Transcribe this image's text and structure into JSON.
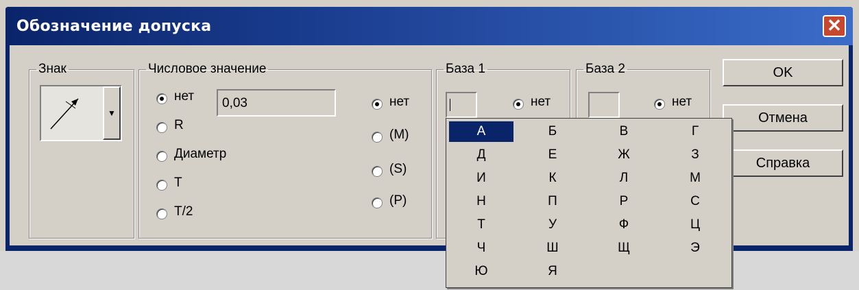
{
  "window": {
    "title": "Обозначение допуска",
    "close_label": "✕"
  },
  "sign_group": {
    "legend": "Знак",
    "dropdown_arrow": "▼"
  },
  "numeric_group": {
    "legend": "Числовое значение",
    "value": "0,03",
    "radios_left": [
      "нет",
      "R",
      "Диаметр",
      "T",
      "T/2"
    ],
    "radios_right": [
      "нет",
      "(M)",
      "(S)",
      "(P)"
    ]
  },
  "base1": {
    "legend": "База 1",
    "radio_label": "нет"
  },
  "base2": {
    "legend": "База 2",
    "radio_label": "нет"
  },
  "buttons": {
    "ok": "OK",
    "cancel": "Отмена",
    "help": "Справка"
  },
  "letters": [
    "А",
    "Б",
    "В",
    "Г",
    "Д",
    "Е",
    "Ж",
    "З",
    "И",
    "К",
    "Л",
    "М",
    "Н",
    "П",
    "Р",
    "С",
    "Т",
    "У",
    "Ф",
    "Ц",
    "Ч",
    "Ш",
    "Щ",
    "Э",
    "Ю",
    "Я"
  ],
  "selected_letter": "А",
  "colors": {
    "title_bar": "#0a246a",
    "selection": "#0a246a",
    "close_button": "#c6482e"
  }
}
